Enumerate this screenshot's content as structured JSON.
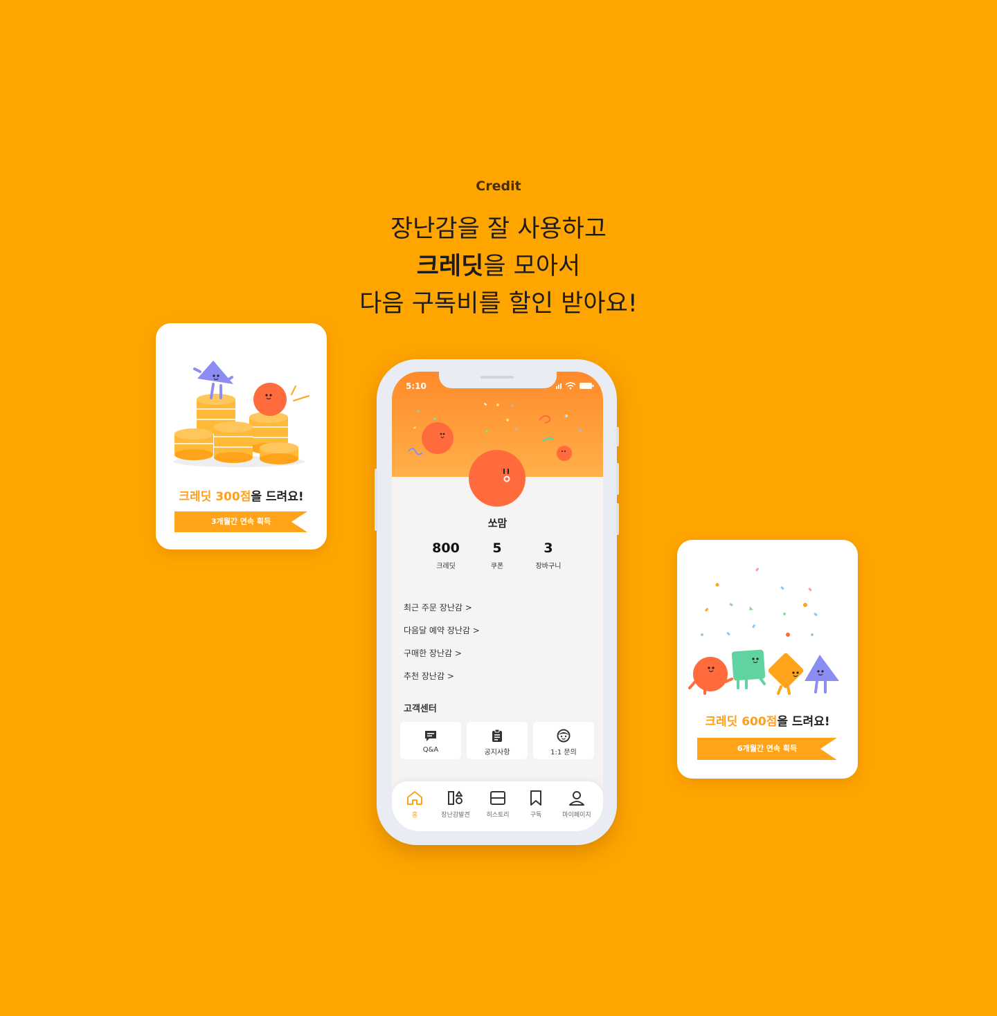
{
  "section_label": "Credit",
  "headline": {
    "line1": "장난감을 잘 사용하고",
    "line2_bold": "크레딧",
    "line2_rest": "을 모아서",
    "line3": "다음 구독비를 할인 받아요!"
  },
  "reward_cards": [
    {
      "highlight": "크레딧 300점",
      "suffix": "을 드려요!",
      "ribbon": "3개월간 연속 획득"
    },
    {
      "highlight": "크레딧 600점",
      "suffix": "을 드려요!",
      "ribbon": "6개월간 연속 획득"
    }
  ],
  "phone": {
    "status_time": "5:10",
    "nickname": "쏘맘",
    "stats": [
      {
        "value": "800",
        "label": "크레딧"
      },
      {
        "value": "5",
        "label": "쿠폰"
      },
      {
        "value": "3",
        "label": "장바구니"
      }
    ],
    "menu": [
      "최근 주문 장난감 >",
      "다음달 예약 장난감 >",
      "구매한 장난감 >",
      "추천 장난감 >"
    ],
    "customer_center": {
      "title": "고객센터",
      "tiles": [
        {
          "label": "Q&A",
          "icon": "chat-icon"
        },
        {
          "label": "공지사항",
          "icon": "clipboard-icon"
        },
        {
          "label": "1:1 문의",
          "icon": "person-face-icon"
        }
      ]
    },
    "tabbar": [
      {
        "label": "홈",
        "icon": "home-icon",
        "active": true
      },
      {
        "label": "장난감발견",
        "icon": "shapes-icon",
        "active": false
      },
      {
        "label": "히스토리",
        "icon": "history-icon",
        "active": false
      },
      {
        "label": "구독",
        "icon": "bookmark-icon",
        "active": false
      },
      {
        "label": "마이페이지",
        "icon": "user-icon",
        "active": false
      }
    ]
  },
  "colors": {
    "background": "#FFA500",
    "accent": "#FFA31A",
    "character_orange": "#FF6B3D",
    "character_blue": "#8C8CF5",
    "character_green": "#5FD3A0"
  }
}
